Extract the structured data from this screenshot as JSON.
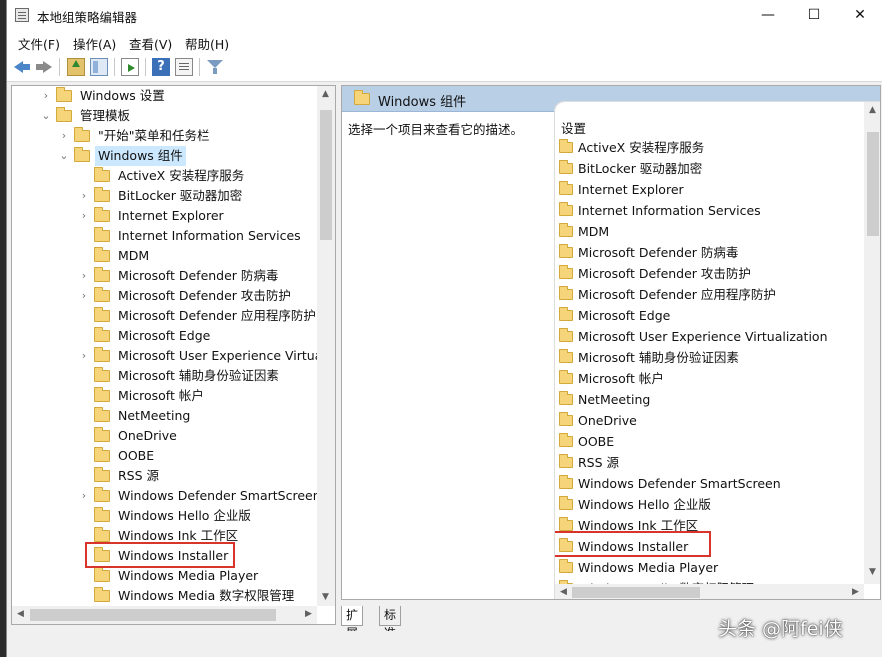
{
  "window": {
    "title": "本地组策略编辑器",
    "minimize": "—",
    "maximize": "☐",
    "close": "✕"
  },
  "menu": [
    "文件(F)",
    "操作(A)",
    "查看(V)",
    "帮助(H)"
  ],
  "toolbar": {
    "icons": [
      "back-arrow-icon",
      "forward-arrow-icon",
      "up-folder-icon",
      "show-hide-tree-icon",
      "export-list-icon",
      "help-icon",
      "properties-icon",
      "filter-icon"
    ],
    "help_glyph": "?"
  },
  "tree": {
    "items": [
      {
        "label": "Windows 设置",
        "expander": "›"
      },
      {
        "label": "管理模板",
        "expander": "⌄"
      },
      {
        "label": "\"开始\"菜单和任务栏",
        "expander": "›"
      },
      {
        "label": "Windows 组件",
        "expander": "⌄",
        "selected": true
      },
      {
        "label": "ActiveX 安装程序服务",
        "expander": ""
      },
      {
        "label": "BitLocker 驱动器加密",
        "expander": "›"
      },
      {
        "label": "Internet Explorer",
        "expander": "›"
      },
      {
        "label": "Internet Information Services",
        "expander": ""
      },
      {
        "label": "MDM",
        "expander": ""
      },
      {
        "label": "Microsoft Defender 防病毒",
        "expander": "›"
      },
      {
        "label": "Microsoft Defender 攻击防护",
        "expander": "›"
      },
      {
        "label": "Microsoft Defender 应用程序防护",
        "expander": ""
      },
      {
        "label": "Microsoft Edge",
        "expander": ""
      },
      {
        "label": "Microsoft User Experience Virtualiz",
        "expander": "›"
      },
      {
        "label": "Microsoft 辅助身份验证因素",
        "expander": ""
      },
      {
        "label": "Microsoft 帐户",
        "expander": ""
      },
      {
        "label": "NetMeeting",
        "expander": ""
      },
      {
        "label": "OneDrive",
        "expander": ""
      },
      {
        "label": "OOBE",
        "expander": ""
      },
      {
        "label": "RSS 源",
        "expander": ""
      },
      {
        "label": "Windows Defender SmartScreen",
        "expander": "›"
      },
      {
        "label": "Windows Hello 企业版",
        "expander": ""
      },
      {
        "label": "Windows Ink 工作区",
        "expander": ""
      },
      {
        "label": "Windows Installer",
        "expander": ""
      },
      {
        "label": "Windows Media Player",
        "expander": ""
      },
      {
        "label": "Windows Media 数字权限管理",
        "expander": ""
      }
    ]
  },
  "right": {
    "header_title": "Windows 组件",
    "description": "选择一个项目来查看它的描述。",
    "list_header": "设置",
    "items": [
      "ActiveX 安装程序服务",
      "BitLocker 驱动器加密",
      "Internet Explorer",
      "Internet Information Services",
      "MDM",
      "Microsoft Defender 防病毒",
      "Microsoft Defender 攻击防护",
      "Microsoft Defender 应用程序防护",
      "Microsoft Edge",
      "Microsoft User Experience Virtualization",
      "Microsoft 辅助身份验证因素",
      "Microsoft 帐户",
      "NetMeeting",
      "OneDrive",
      "OOBE",
      "RSS 源",
      "Windows Defender SmartScreen",
      "Windows Hello 企业版",
      "Windows Ink 工作区",
      "Windows Installer",
      "Windows Media Player",
      "Windows Media 数字权限管理"
    ]
  },
  "tabs": [
    "扩展",
    "标准"
  ],
  "watermark": "头条 @阿fei侠",
  "colors": {
    "highlight": "#d9342b",
    "selected_bg": "#cce8ff",
    "header_bg": "#b9cfe6"
  }
}
